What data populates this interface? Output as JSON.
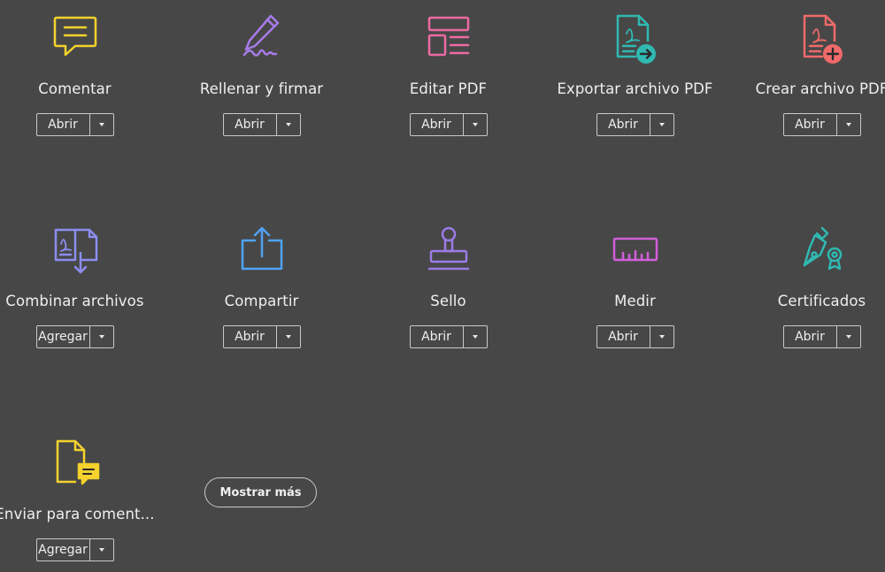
{
  "tools": [
    {
      "label": "Comentar",
      "button": "Abrir",
      "icon": "comment-icon",
      "color": "#f5d22d"
    },
    {
      "label": "Rellenar y firmar",
      "button": "Abrir",
      "icon": "fill-sign-pen-icon",
      "color": "#a77be8"
    },
    {
      "label": "Editar PDF",
      "button": "Abrir",
      "icon": "edit-pdf-icon",
      "color": "#ed6aa4"
    },
    {
      "label": "Exportar archivo PDF",
      "button": "Abrir",
      "icon": "export-pdf-icon",
      "color": "#30b9b2"
    },
    {
      "label": "Crear archivo PDF",
      "button": "Abrir",
      "icon": "create-pdf-icon",
      "color": "#f06a6a"
    },
    {
      "label": "Combinar archivos",
      "button": "Agregar",
      "icon": "combine-files-icon",
      "color": "#8c8ef0"
    },
    {
      "label": "Compartir",
      "button": "Abrir",
      "icon": "share-icon",
      "color": "#4fa3f2"
    },
    {
      "label": "Sello",
      "button": "Abrir",
      "icon": "stamp-icon",
      "color": "#9b7be6"
    },
    {
      "label": "Medir",
      "button": "Abrir",
      "icon": "measure-ruler-icon",
      "color": "#d25fdc"
    },
    {
      "label": "Certificados",
      "button": "Abrir",
      "icon": "certificate-pen-icon",
      "color": "#30b9b2"
    },
    {
      "label": "Enviar para coment...",
      "button": "Agregar",
      "icon": "send-comments-icon",
      "color": "#f5d22d"
    }
  ],
  "show_more": {
    "label": "Mostrar más"
  }
}
